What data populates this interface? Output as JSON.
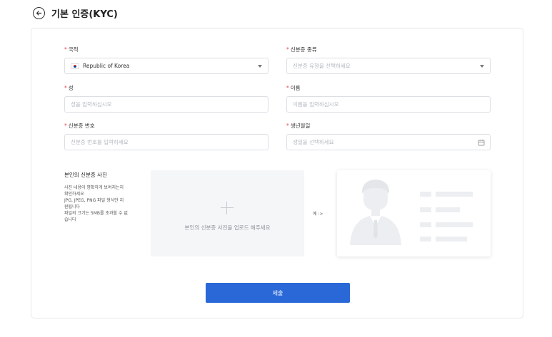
{
  "header": {
    "title": "기본 인증(KYC)",
    "back_icon": "arrow-left-icon"
  },
  "form": {
    "nationality": {
      "label": "국적",
      "value": "Republic of Korea",
      "flag_icon": "korea-flag-icon"
    },
    "id_type": {
      "label": "신분증 종류",
      "placeholder": "신분증 유형을 선택하세요"
    },
    "last_name": {
      "label": "성",
      "placeholder": "성을 입력하십시오"
    },
    "first_name": {
      "label": "이름",
      "placeholder": "이름을 입력하십시오"
    },
    "id_number": {
      "label": "신분증 번호",
      "placeholder": "신분증 번호를 입력하세요"
    },
    "birth_date": {
      "label": "생년월일",
      "placeholder": "생일을 선택하세요",
      "icon": "calendar-icon"
    },
    "required_mark": "*"
  },
  "upload": {
    "title": "본인의 신분증 사진",
    "desc_lines": [
      "사진 내용이 명확하게 보여지는지",
      "확인하세요",
      "JPG, JPEG, PNG 파일 형식만 지",
      "원됩니다",
      "파일의 크기는 5MB를 초과할 수 없",
      "습니다"
    ],
    "box_text": "본인의 신분증 사진을 업로드 해주세요",
    "example_label": "예 :>"
  },
  "submit_label": "제출",
  "colors": {
    "primary": "#2a68d8",
    "required": "#e5484d",
    "border": "#dcdfe4"
  }
}
